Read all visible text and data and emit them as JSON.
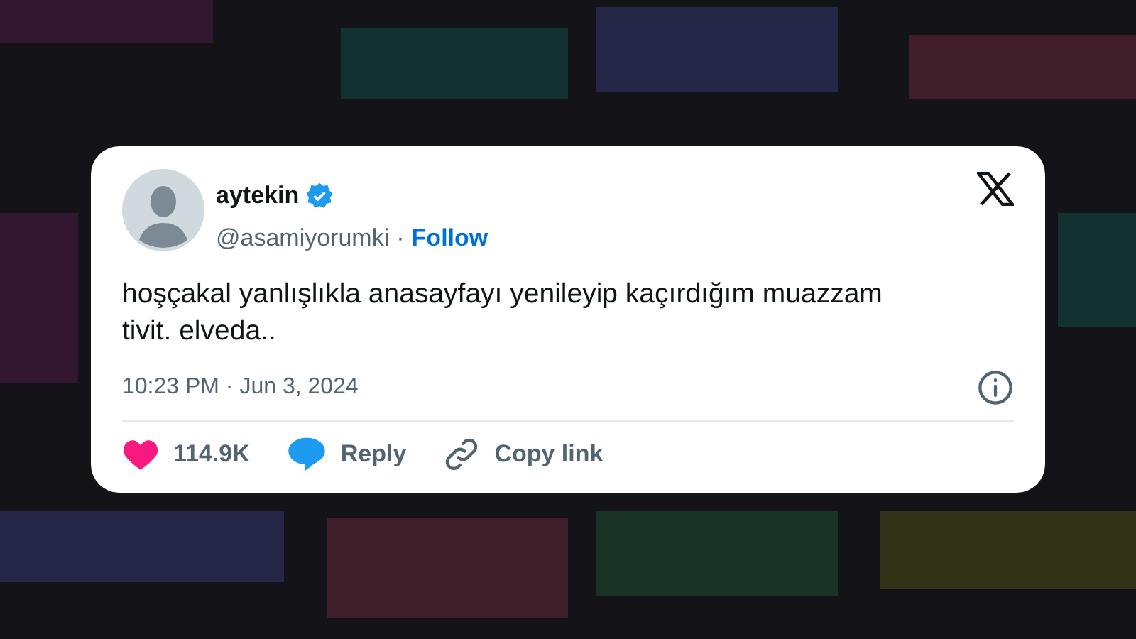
{
  "tweet": {
    "author": {
      "name": "aytekin",
      "verified": true,
      "handle": "@asamiyorumki",
      "separator": "·",
      "follow": "Follow"
    },
    "text": "hoşçakal yanlışlıkla anasayfayı yenileyip kaçırdığım muazzam tivit. elveda..",
    "timestamp": "10:23 PM · Jun 3, 2024",
    "actions": [
      {
        "kind": "like",
        "label": "114.9K"
      },
      {
        "kind": "reply",
        "label": "Reply"
      },
      {
        "kind": "copy",
        "label": "Copy link"
      }
    ]
  }
}
